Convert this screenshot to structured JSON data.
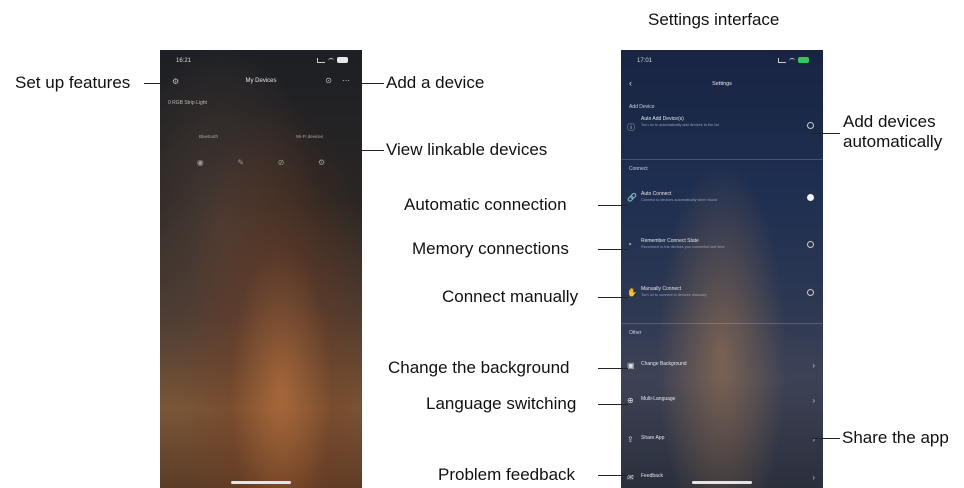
{
  "header": {
    "title": "Settings interface"
  },
  "callouts": {
    "set_up_features": "Set up features",
    "add_device": "Add a device",
    "view_linkable": "View linkable devices",
    "add_auto_1": "Add devices",
    "add_auto_2": "automatically",
    "auto_connection": "Automatic connection",
    "memory_connections": "Memory connections",
    "connect_manually": "Connect manually",
    "change_background": "Change the background",
    "language_switching": "Language switching",
    "share_app": "Share the app",
    "problem_feedback": "Problem feedback"
  },
  "home_screen": {
    "time": "16:21",
    "title": "My Devices",
    "subtitle": "0 RGB Strip Light",
    "tab_left": "Bluetooth",
    "tab_right": "Wi-Fi devices",
    "icons": [
      "palette-icon",
      "brush-icon",
      "link-icon",
      "gear-icon"
    ]
  },
  "settings_screen": {
    "time": "17:01",
    "title": "Settings",
    "sections": {
      "add_device": "Add Device",
      "connect": "Connect",
      "other": "Other"
    },
    "rows": {
      "auto_add": {
        "label": "Auto Add Device(s)",
        "desc": "Turn on to automatically add devices to the list"
      },
      "auto_connect": {
        "label": "Auto Connect",
        "desc": "Connect to devices automatically when found"
      },
      "remember": {
        "label": "Remember Connect State",
        "desc": "Reconnect to the devices you connected last time"
      },
      "manual": {
        "label": "Manually Connect",
        "desc": "Turn on to connect to devices manually"
      },
      "background": {
        "label": "Change Background"
      },
      "language": {
        "label": "Multi-Language"
      },
      "share": {
        "label": "Share App"
      },
      "feedback": {
        "label": "Feedback"
      }
    }
  }
}
